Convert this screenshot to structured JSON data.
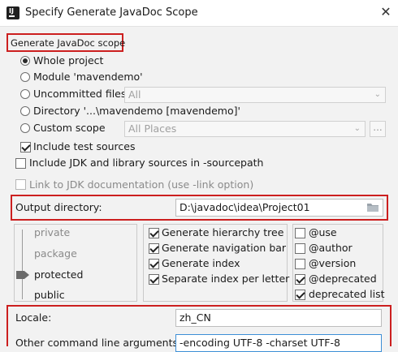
{
  "window": {
    "title": "Specify Generate JavaDoc Scope",
    "close_glyph": "✕"
  },
  "scope": {
    "group_title": "Generate JavaDoc scope",
    "whole_project": "Whole project",
    "module": "Module 'mavendemo'",
    "uncommitted": "Uncommitted files",
    "uncommitted_combo": "All",
    "directory": "Directory '...\\mavendemo [mavendemo]'",
    "custom_scope": "Custom scope",
    "custom_combo": "All Places",
    "custom_dots": "...",
    "include_test": "Include test sources",
    "selected": "Whole project"
  },
  "options": {
    "include_jdk": "Include JDK and library sources in -sourcepath",
    "link_jdk": "Link to JDK documentation (use -link option)"
  },
  "output": {
    "label": "Output directory:",
    "value": "D:\\javadoc\\idea\\Project01"
  },
  "visibility": {
    "levels": [
      "private",
      "package",
      "protected",
      "public"
    ],
    "selected": "protected"
  },
  "generate": {
    "items": [
      {
        "label": "Generate hierarchy tree",
        "checked": true
      },
      {
        "label": "Generate navigation bar",
        "checked": true
      },
      {
        "label": "Generate index",
        "checked": true
      },
      {
        "label": "Separate index per letter",
        "checked": true
      }
    ]
  },
  "tags": {
    "items": [
      {
        "label": "@use",
        "checked": false
      },
      {
        "label": "@author",
        "checked": false
      },
      {
        "label": "@version",
        "checked": false
      },
      {
        "label": "@deprecated",
        "checked": true
      },
      {
        "label": "deprecated list",
        "checked": true
      }
    ]
  },
  "locale": {
    "label": "Locale:",
    "value": "zh_CN"
  },
  "other_args": {
    "label": "Other command line arguments:",
    "value": "-encoding UTF-8 -charset UTF-8"
  },
  "colors": {
    "highlight_border": "#cc1f1f",
    "focus_border": "#3d8fd6",
    "background": "#f2f2f2"
  }
}
